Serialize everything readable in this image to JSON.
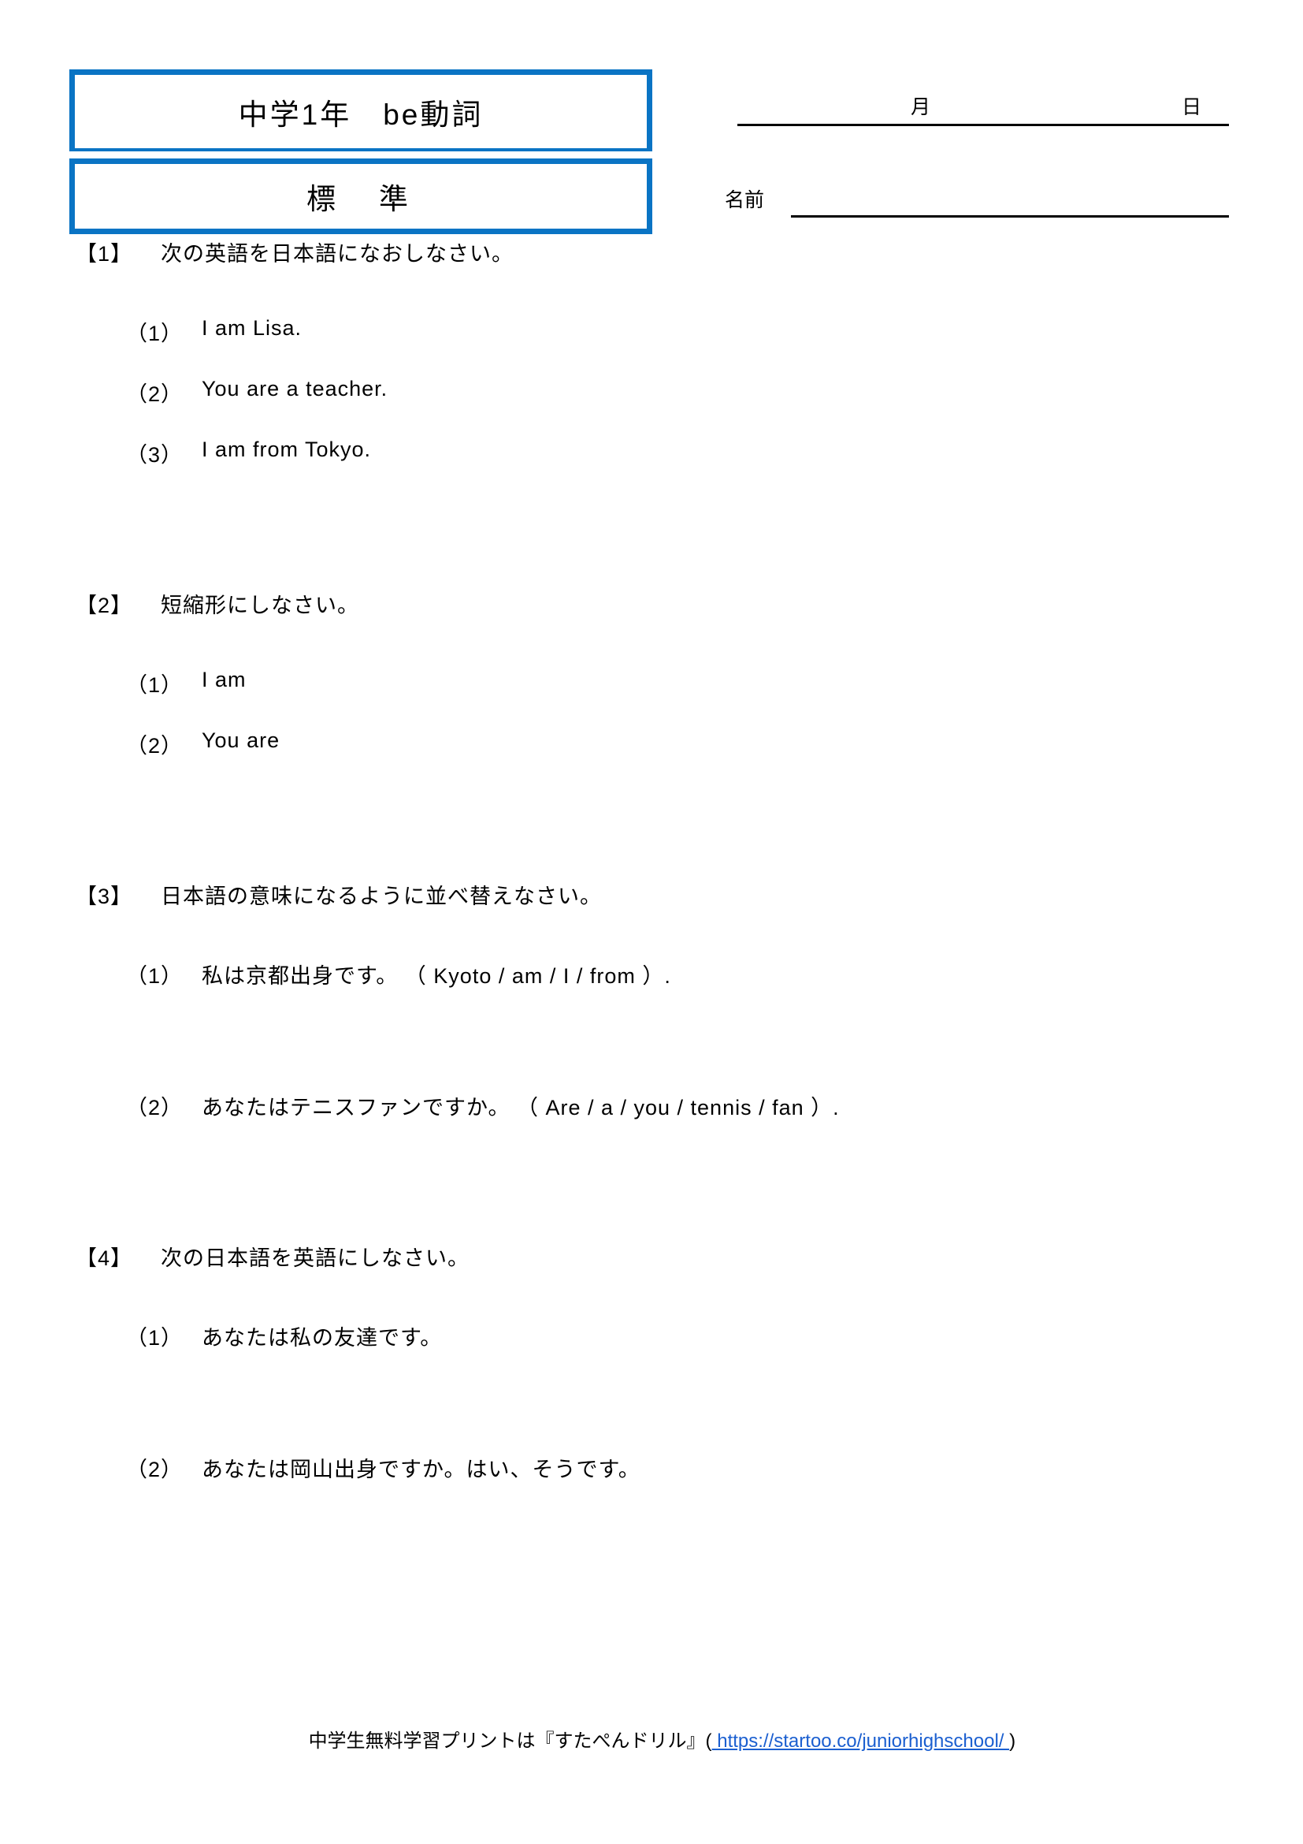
{
  "header": {
    "title": "中学1年　be動詞",
    "level": "標　準",
    "date_month_label": "月",
    "date_day_label": "日",
    "name_label": "名前"
  },
  "sections": [
    {
      "number": "【1】",
      "title": "次の英語を日本語になおしなさい。",
      "questions": [
        {
          "no": "（1）",
          "text": "I am Lisa."
        },
        {
          "no": "（2）",
          "text": "You are a teacher."
        },
        {
          "no": "（3）",
          "text": "I am from Tokyo."
        }
      ]
    },
    {
      "number": "【2】",
      "title": "短縮形にしなさい。",
      "questions": [
        {
          "no": "（1）",
          "text": "I am"
        },
        {
          "no": "（2）",
          "text": "You are"
        }
      ]
    },
    {
      "number": "【3】",
      "title": "日本語の意味になるように並べ替えなさい。",
      "questions": [
        {
          "no": "（1）",
          "text": "私は京都出身です。 （ Kyoto / am / I / from ）."
        },
        {
          "no": "（2）",
          "text": "あなたはテニスファンですか。 （ Are / a / you / tennis / fan ）."
        }
      ]
    },
    {
      "number": "【4】",
      "title": "次の日本語を英語にしなさい。",
      "questions": [
        {
          "no": "（1）",
          "text": "あなたは私の友達です。"
        },
        {
          "no": "（2）",
          "text": "あなたは岡山出身ですか。はい、そうです。"
        }
      ]
    }
  ],
  "footer": {
    "before": "中学生無料学習プリントは『すたぺんドリル』(",
    "link": " https://startoo.co/juniorhighschool/ ",
    "after": ")"
  },
  "colors": {
    "accent": "#0a74c4",
    "link": "#1b5fd0",
    "text": "#000000"
  }
}
